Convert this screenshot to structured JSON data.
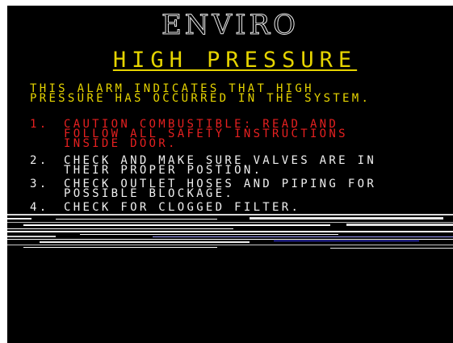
{
  "screen": {
    "brand": "ENVIRO",
    "alarm_title": "HIGH PRESSURE",
    "description": [
      "THIS ALARM INDICATES THAT HIGH",
      "PRESSURE HAS OCCURRED IN THE SYSTEM."
    ],
    "steps": [
      {
        "number": "1.",
        "lines": [
          "CAUTION COMBUSTIBLE: READ AND",
          "FOLLOW ALL SAFETY INSTRUCTIONS",
          "INSIDE DOOR."
        ],
        "color": "#e62020"
      },
      {
        "number": "2.",
        "lines": [
          "CHECK AND MAKE SURE VALVES ARE IN",
          "THEIR PROPER POSTION."
        ],
        "color": "#f0f0f0"
      },
      {
        "number": "3.",
        "lines": [
          "CHECK OUTLET HOSES AND PIPING FOR",
          "POSSIBLE BLOCKAGE."
        ],
        "color": "#f0f0f0"
      },
      {
        "number": "4.",
        "lines": [
          "CHECK FOR CLOGGED FILTER."
        ],
        "color": "#f0f0f0"
      }
    ]
  },
  "colors": {
    "background": "#000000",
    "title": "#e6d400",
    "caution": "#e62020",
    "instruction": "#f0f0f0"
  }
}
